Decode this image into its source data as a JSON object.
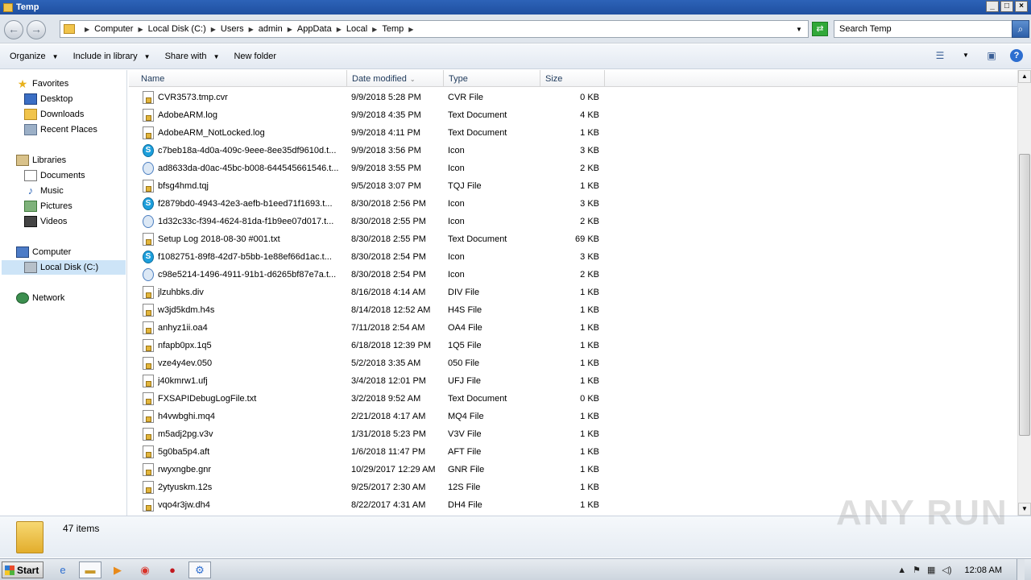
{
  "window": {
    "title": "Temp"
  },
  "address": {
    "crumbs": [
      "Computer",
      "Local Disk (C:)",
      "Users",
      "admin",
      "AppData",
      "Local",
      "Temp"
    ],
    "search_placeholder": "Search Temp"
  },
  "toolbar": {
    "organize": "Organize",
    "include_in_library": "Include in library",
    "share_with": "Share with",
    "new_folder": "New folder"
  },
  "nav": {
    "favorites": "Favorites",
    "desktop": "Desktop",
    "downloads": "Downloads",
    "recent_places": "Recent Places",
    "libraries": "Libraries",
    "documents": "Documents",
    "music": "Music",
    "pictures": "Pictures",
    "videos": "Videos",
    "computer": "Computer",
    "local_disk": "Local Disk (C:)",
    "network": "Network"
  },
  "columns": {
    "name": "Name",
    "date": "Date modified",
    "type": "Type",
    "size": "Size"
  },
  "files": [
    {
      "name": "CVR3573.tmp.cvr",
      "date": "9/9/2018 5:28 PM",
      "type": "CVR File",
      "size": "0 KB",
      "icon": "locked-file"
    },
    {
      "name": "AdobeARM.log",
      "date": "9/9/2018 4:35 PM",
      "type": "Text Document",
      "size": "4 KB",
      "icon": "locked-file"
    },
    {
      "name": "AdobeARM_NotLocked.log",
      "date": "9/9/2018 4:11 PM",
      "type": "Text Document",
      "size": "1 KB",
      "icon": "locked-file"
    },
    {
      "name": "c7beb18a-4d0a-409c-9eee-8ee35df9610d.t...",
      "date": "9/9/2018 3:56 PM",
      "type": "Icon",
      "size": "3 KB",
      "icon": "skype"
    },
    {
      "name": "ad8633da-d0ac-45bc-b008-644545661546.t...",
      "date": "9/9/2018 3:55 PM",
      "type": "Icon",
      "size": "2 KB",
      "icon": "chrome"
    },
    {
      "name": "bfsg4hmd.tqj",
      "date": "9/5/2018 3:07 PM",
      "type": "TQJ File",
      "size": "1 KB",
      "icon": "locked-file"
    },
    {
      "name": "f2879bd0-4943-42e3-aefb-b1eed71f1693.t...",
      "date": "8/30/2018 2:56 PM",
      "type": "Icon",
      "size": "3 KB",
      "icon": "skype"
    },
    {
      "name": "1d32c33c-f394-4624-81da-f1b9ee07d017.t...",
      "date": "8/30/2018 2:55 PM",
      "type": "Icon",
      "size": "2 KB",
      "icon": "chrome"
    },
    {
      "name": "Setup Log 2018-08-30 #001.txt",
      "date": "8/30/2018 2:55 PM",
      "type": "Text Document",
      "size": "69 KB",
      "icon": "locked-file"
    },
    {
      "name": "f1082751-89f8-42d7-b5bb-1e88ef66d1ac.t...",
      "date": "8/30/2018 2:54 PM",
      "type": "Icon",
      "size": "3 KB",
      "icon": "skype"
    },
    {
      "name": "c98e5214-1496-4911-91b1-d6265bf87e7a.t...",
      "date": "8/30/2018 2:54 PM",
      "type": "Icon",
      "size": "2 KB",
      "icon": "chrome"
    },
    {
      "name": "jlzuhbks.div",
      "date": "8/16/2018 4:14 AM",
      "type": "DIV File",
      "size": "1 KB",
      "icon": "locked-file"
    },
    {
      "name": "w3jd5kdm.h4s",
      "date": "8/14/2018 12:52 AM",
      "type": "H4S File",
      "size": "1 KB",
      "icon": "locked-file"
    },
    {
      "name": "anhyz1ii.oa4",
      "date": "7/11/2018 2:54 AM",
      "type": "OA4 File",
      "size": "1 KB",
      "icon": "locked-file"
    },
    {
      "name": "nfapb0px.1q5",
      "date": "6/18/2018 12:39 PM",
      "type": "1Q5 File",
      "size": "1 KB",
      "icon": "locked-file"
    },
    {
      "name": "vze4y4ev.050",
      "date": "5/2/2018 3:35 AM",
      "type": "050 File",
      "size": "1 KB",
      "icon": "locked-file"
    },
    {
      "name": "j40kmrw1.ufj",
      "date": "3/4/2018 12:01 PM",
      "type": "UFJ File",
      "size": "1 KB",
      "icon": "locked-file"
    },
    {
      "name": "FXSAPIDebugLogFile.txt",
      "date": "3/2/2018 9:52 AM",
      "type": "Text Document",
      "size": "0 KB",
      "icon": "locked-file"
    },
    {
      "name": "h4vwbghi.mq4",
      "date": "2/21/2018 4:17 AM",
      "type": "MQ4 File",
      "size": "1 KB",
      "icon": "locked-file"
    },
    {
      "name": "m5adj2pg.v3v",
      "date": "1/31/2018 5:23 PM",
      "type": "V3V File",
      "size": "1 KB",
      "icon": "locked-file"
    },
    {
      "name": "5g0ba5p4.aft",
      "date": "1/6/2018 11:47 PM",
      "type": "AFT File",
      "size": "1 KB",
      "icon": "locked-file"
    },
    {
      "name": "rwyxngbe.gnr",
      "date": "10/29/2017 12:29 AM",
      "type": "GNR File",
      "size": "1 KB",
      "icon": "locked-file"
    },
    {
      "name": "2ytyuskm.12s",
      "date": "9/25/2017 2:30 AM",
      "type": "12S File",
      "size": "1 KB",
      "icon": "locked-file"
    },
    {
      "name": "vqo4r3jw.dh4",
      "date": "8/22/2017 4:31 AM",
      "type": "DH4 File",
      "size": "1 KB",
      "icon": "locked-file"
    }
  ],
  "details": {
    "item_count": "47 items"
  },
  "watermark": "ANY RUN",
  "taskbar": {
    "start": "Start",
    "clock": "12:08 AM"
  },
  "colors": {
    "titlebar": "#2d63b8",
    "selection": "#cde4f7"
  }
}
